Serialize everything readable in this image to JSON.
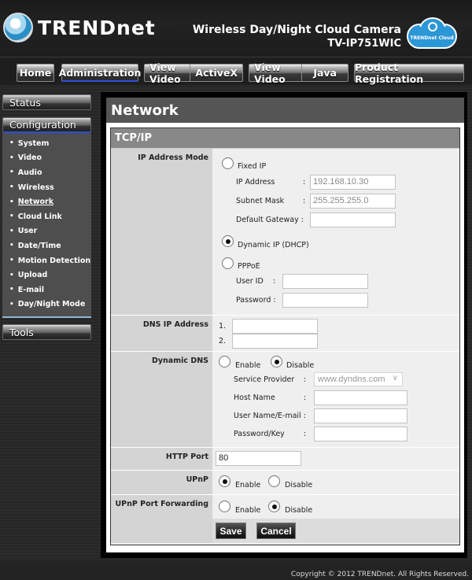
{
  "header": {
    "brand": "TRENDnet",
    "product_title": "Wireless Day/Night Cloud Camera",
    "model": "TV-IP751WIC",
    "cloud_badge": "TRENDnet Cloud"
  },
  "topnav": {
    "home": "Home",
    "administration": "Administration",
    "view_video_1": "View Video",
    "activex": "ActiveX",
    "view_video_2": "View Video",
    "java": "Java",
    "product_registration": "Product Registration"
  },
  "sidebar": {
    "status": "Status",
    "configuration": "Configuration",
    "tools": "Tools",
    "items": [
      {
        "label": "System"
      },
      {
        "label": "Video"
      },
      {
        "label": "Audio"
      },
      {
        "label": "Wireless"
      },
      {
        "label": "Network"
      },
      {
        "label": "Cloud Link"
      },
      {
        "label": "User"
      },
      {
        "label": "Date/Time"
      },
      {
        "label": "Motion Detection"
      },
      {
        "label": "Upload"
      },
      {
        "label": "E-mail"
      },
      {
        "label": "Day/Night Mode"
      }
    ],
    "current": "Network"
  },
  "page": {
    "title": "Network",
    "section": "TCP/IP"
  },
  "ip_mode": {
    "label": "IP Address Mode",
    "fixed_ip": "Fixed IP",
    "ip_address_label": "IP Address",
    "ip_address_value": "192.168.10.30",
    "subnet_label": "Subnet Mask",
    "subnet_value": "255.255.255.0",
    "gateway_label": "Default Gateway :",
    "gateway_value": "",
    "colon": ":",
    "dhcp": "Dynamic IP (DHCP)",
    "pppoe": "PPPoE",
    "user_id_label": "User ID",
    "password_label": "Password :",
    "selected": "Dynamic IP (DHCP)"
  },
  "dns": {
    "label": "DNS IP Address",
    "n1": "1.",
    "n2": "2.",
    "dns1": "",
    "dns2": ""
  },
  "ddns": {
    "label": "Dynamic DNS",
    "enable": "Enable",
    "disable": "Disable",
    "selected": "Disable",
    "provider_label": "Service Provider",
    "provider_value": "www.dyndns.com",
    "host_label": "Host Name",
    "user_label": "User Name/E-mail :",
    "key_label": "Password/Key"
  },
  "http": {
    "label": "HTTP Port",
    "value": "80"
  },
  "upnp": {
    "label": "UPnP",
    "enable": "Enable",
    "disable": "Disable",
    "selected": "Enable"
  },
  "upnp_pf": {
    "label": "UPnP Port Forwarding",
    "enable": "Enable",
    "disable": "Disable",
    "selected": "Disable"
  },
  "buttons": {
    "save": "Save",
    "cancel": "Cancel"
  },
  "footer": {
    "copyright": "Copyright © 2012 TRENDnet.  All Rights Reserved."
  }
}
